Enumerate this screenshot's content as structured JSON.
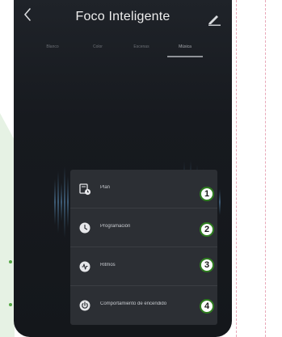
{
  "header": {
    "title": "Foco Inteligente",
    "back_icon": "chevron-left-icon",
    "edit_icon": "pencil-icon"
  },
  "tabs": [
    {
      "label": "Blanco",
      "active": false
    },
    {
      "label": "Color",
      "active": false
    },
    {
      "label": "Escenas",
      "active": false
    },
    {
      "label": "Música",
      "active": true
    }
  ],
  "menu": {
    "items": [
      {
        "label": "Plan",
        "icon": "timer-calendar-icon",
        "badge": "1"
      },
      {
        "label": "Programación",
        "icon": "clock-icon",
        "badge": "2"
      },
      {
        "label": "Ritmos",
        "icon": "rhythm-icon",
        "badge": "3"
      },
      {
        "label": "Comportamiento de encendido",
        "icon": "power-icon",
        "badge": "4"
      }
    ]
  },
  "colors": {
    "badge_border": "#2e7d1f",
    "accent_green": "#56a846",
    "panel_bg": "#e6f2e4"
  }
}
